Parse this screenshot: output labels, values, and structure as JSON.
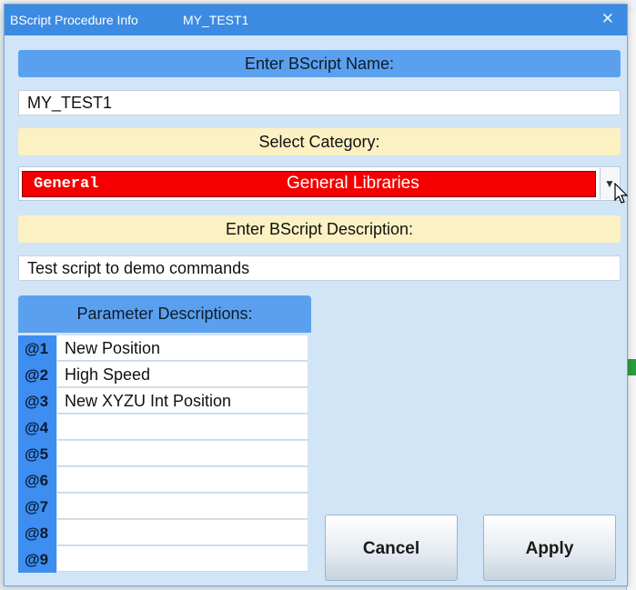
{
  "dialog": {
    "app_title": "BScript Procedure Info",
    "script_name_title": "MY_TEST1",
    "close_glyph": "✕"
  },
  "name_section": {
    "label": "Enter BScript Name:",
    "value": "MY_TEST1"
  },
  "category_section": {
    "label": "Select Category:",
    "selected_code": "General",
    "selected_label": "General Libraries",
    "selected_color": "#f40000"
  },
  "description_section": {
    "label": "Enter BScript Description:",
    "value": "Test script to demo commands"
  },
  "parameters": {
    "header": "Parameter Descriptions:",
    "rows": [
      {
        "id": "@1",
        "value": "New Position"
      },
      {
        "id": "@2",
        "value": "High Speed"
      },
      {
        "id": "@3",
        "value": "New XYZU Int Position"
      },
      {
        "id": "@4",
        "value": ""
      },
      {
        "id": "@5",
        "value": ""
      },
      {
        "id": "@6",
        "value": ""
      },
      {
        "id": "@7",
        "value": ""
      },
      {
        "id": "@8",
        "value": ""
      },
      {
        "id": "@9",
        "value": ""
      }
    ]
  },
  "buttons": {
    "cancel": "Cancel",
    "apply": "Apply"
  },
  "colors": {
    "titlebar": "#3b8be3",
    "section_blue": "#5aa0ef",
    "section_yellow": "#fbf1c2",
    "dialog_bg": "#d2e5f7",
    "param_id_bg": "#3d8ef0"
  },
  "icons": {
    "close": "close-icon",
    "dropdown": "chevron-down-icon",
    "cursor": "mouse-pointer-icon"
  }
}
